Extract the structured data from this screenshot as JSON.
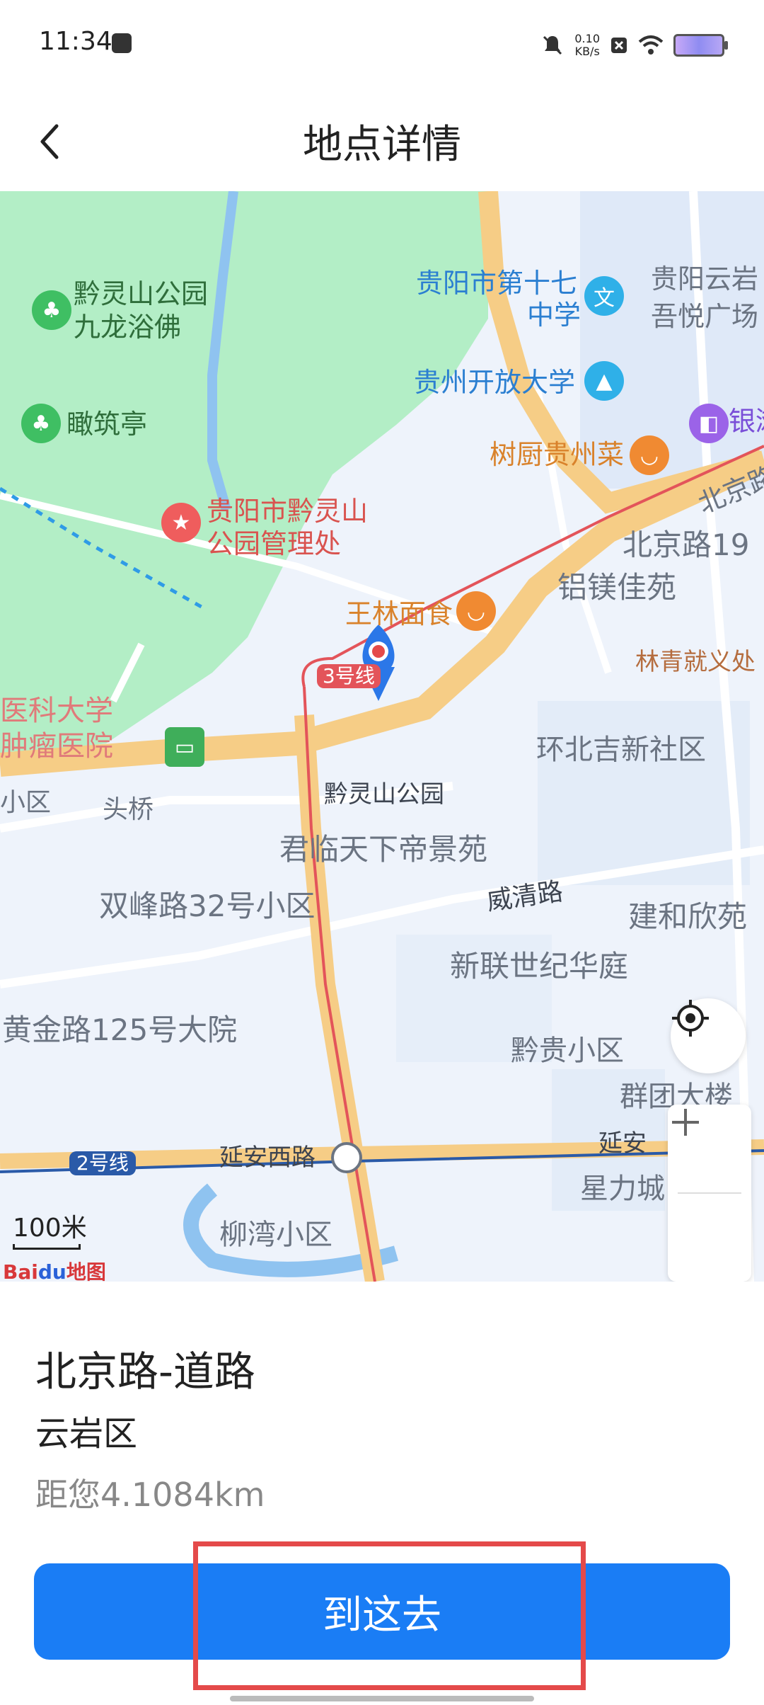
{
  "status_bar": {
    "time": "11:34",
    "network_speed_value": "0.10",
    "network_speed_unit": "KB/s"
  },
  "header": {
    "title": "地点详情"
  },
  "map": {
    "labels": {
      "park": "黔灵山公园",
      "buddha": "九龙浴佛",
      "pavilion": "瞰筑亭",
      "park_office_1": "贵阳市黔灵山",
      "park_office_2": "公园管理处",
      "school17_1": "贵阳市第十七",
      "school17_2": "中学",
      "open_univ": "贵州开放大学",
      "yunyan_1": "贵阳云岩",
      "yunyan_2": "吾悦广场",
      "bank": "银滩",
      "restaurant": "树厨贵州菜",
      "beijing_rd_street": "北京路",
      "beijing_19": "北京路19",
      "lvmei": "铝镁佳苑",
      "wanglin": "王林面食",
      "linqing": "林青就义处",
      "medical_1": "医科大学",
      "medical_2": "肿瘤医院",
      "line3": "3号线",
      "huanbei": "环北吉新社区",
      "station": "黔灵山公园",
      "xiaoqu": "小区",
      "toutiao": "头桥",
      "junlin": "君临天下帝景苑",
      "shuangfeng": "双峰路32号小区",
      "weiqing": "威清路",
      "jianhe": "建和欣苑",
      "xinlian": "新联世纪华庭",
      "huangjin": "黄金路125号大院",
      "qiangui": "黔贵小区",
      "qunlou": "群团大楼",
      "line2": "2号线",
      "yanan_west": "延安西路",
      "yanan": "延安",
      "xingli": "星力城",
      "liuwan": "柳湾小区"
    },
    "scale": "100米",
    "logo_bai": "Bai",
    "logo_du": "du",
    "logo_map": "地图"
  },
  "place": {
    "name": "北京路-道路",
    "district": "云岩区",
    "distance": "距您4.1084km"
  },
  "action": {
    "go_label": "到这去"
  },
  "colors": {
    "primary": "#1a7df5",
    "highlight": "#e44a4a",
    "park_green": "#b3eec6",
    "road_yellow": "#f6cd86",
    "metro_red": "#e3545a",
    "metro_blue": "#2a5aa8"
  }
}
